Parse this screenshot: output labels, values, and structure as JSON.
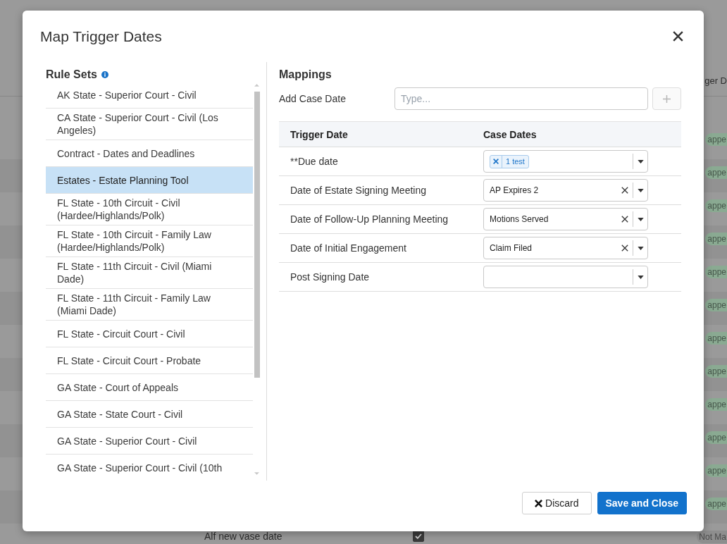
{
  "background_page": {
    "column_header": "ger D",
    "rows": [
      {
        "status": "appe",
        "color": "#8aaa92"
      },
      {
        "status": "appe",
        "color": "#8aaa92"
      },
      {
        "status": "appe",
        "color": "#8aaa92"
      },
      {
        "status": "appe",
        "color": "#8aaa92"
      },
      {
        "status": "appe",
        "color": "#8aaa92"
      },
      {
        "status": "appe",
        "color": "#8aaa92"
      },
      {
        "status": "appe",
        "color": "#8aaa92"
      },
      {
        "status": "appe",
        "color": "#8aaa92"
      },
      {
        "status": "appe",
        "color": "#8aaa92"
      },
      {
        "status": "appe",
        "color": "#8aaa92"
      },
      {
        "status": "appe",
        "color": "#8aaa92"
      },
      {
        "status": "appe",
        "color": "#8aaa92"
      },
      {
        "label": "Alf new vase date",
        "checked": true,
        "status": "Not Ma",
        "color": "#8e8e8e"
      }
    ]
  },
  "dialog": {
    "title": "Map Trigger Dates",
    "rule_sets": {
      "title": "Rule Sets",
      "items": [
        {
          "label": "AK State - Superior Court - Civil",
          "selected": false
        },
        {
          "label": "CA State - Superior Court - Civil (Los Angeles)",
          "selected": false
        },
        {
          "label": "Contract - Dates and Deadlines",
          "selected": false
        },
        {
          "label": "Estates - Estate Planning Tool",
          "selected": true
        },
        {
          "label": "FL State - 10th Circuit - Civil (Hardee/Highlands/Polk)",
          "selected": false
        },
        {
          "label": "FL State - 10th Circuit - Family Law (Hardee/Highlands/Polk)",
          "selected": false
        },
        {
          "label": "FL State - 11th Circuit - Civil (Miami Dade)",
          "selected": false
        },
        {
          "label": "FL State - 11th Circuit - Family Law (Miami Dade)",
          "selected": false
        },
        {
          "label": "FL State - Circuit Court - Civil",
          "selected": false
        },
        {
          "label": "FL State - Circuit Court - Probate",
          "selected": false
        },
        {
          "label": "GA State - Court of Appeals",
          "selected": false
        },
        {
          "label": "GA State - State Court - Civil",
          "selected": false
        },
        {
          "label": "GA State - Superior Court - Civil",
          "selected": false
        },
        {
          "label": "GA State - Superior Court - Civil (10th",
          "selected": false
        }
      ]
    },
    "mappings": {
      "title": "Mappings",
      "add_case_date": {
        "label": "Add Case Date",
        "placeholder": "Type..."
      },
      "add_button": {
        "disabled": true
      },
      "table": {
        "columns": [
          "Trigger Date",
          "Case Dates"
        ],
        "rows": [
          {
            "trigger_date": "**Due date",
            "case_dates": {
              "kind": "multi",
              "tags": [
                "1 test"
              ]
            }
          },
          {
            "trigger_date": "Date of Estate Signing Meeting",
            "case_dates": {
              "kind": "single",
              "value": "AP Expires 2"
            }
          },
          {
            "trigger_date": "Date of Follow-Up Planning Meeting",
            "case_dates": {
              "kind": "single",
              "value": "Motions Served"
            }
          },
          {
            "trigger_date": "Date of Initial Engagement",
            "case_dates": {
              "kind": "single",
              "value": "Claim Filed"
            }
          },
          {
            "trigger_date": "Post Signing Date",
            "case_dates": {
              "kind": "single"
            }
          }
        ]
      }
    },
    "buttons": [
      {
        "label": "Discard",
        "kind": "secondary"
      },
      {
        "label": "Save and Close",
        "kind": "primary"
      }
    ]
  }
}
